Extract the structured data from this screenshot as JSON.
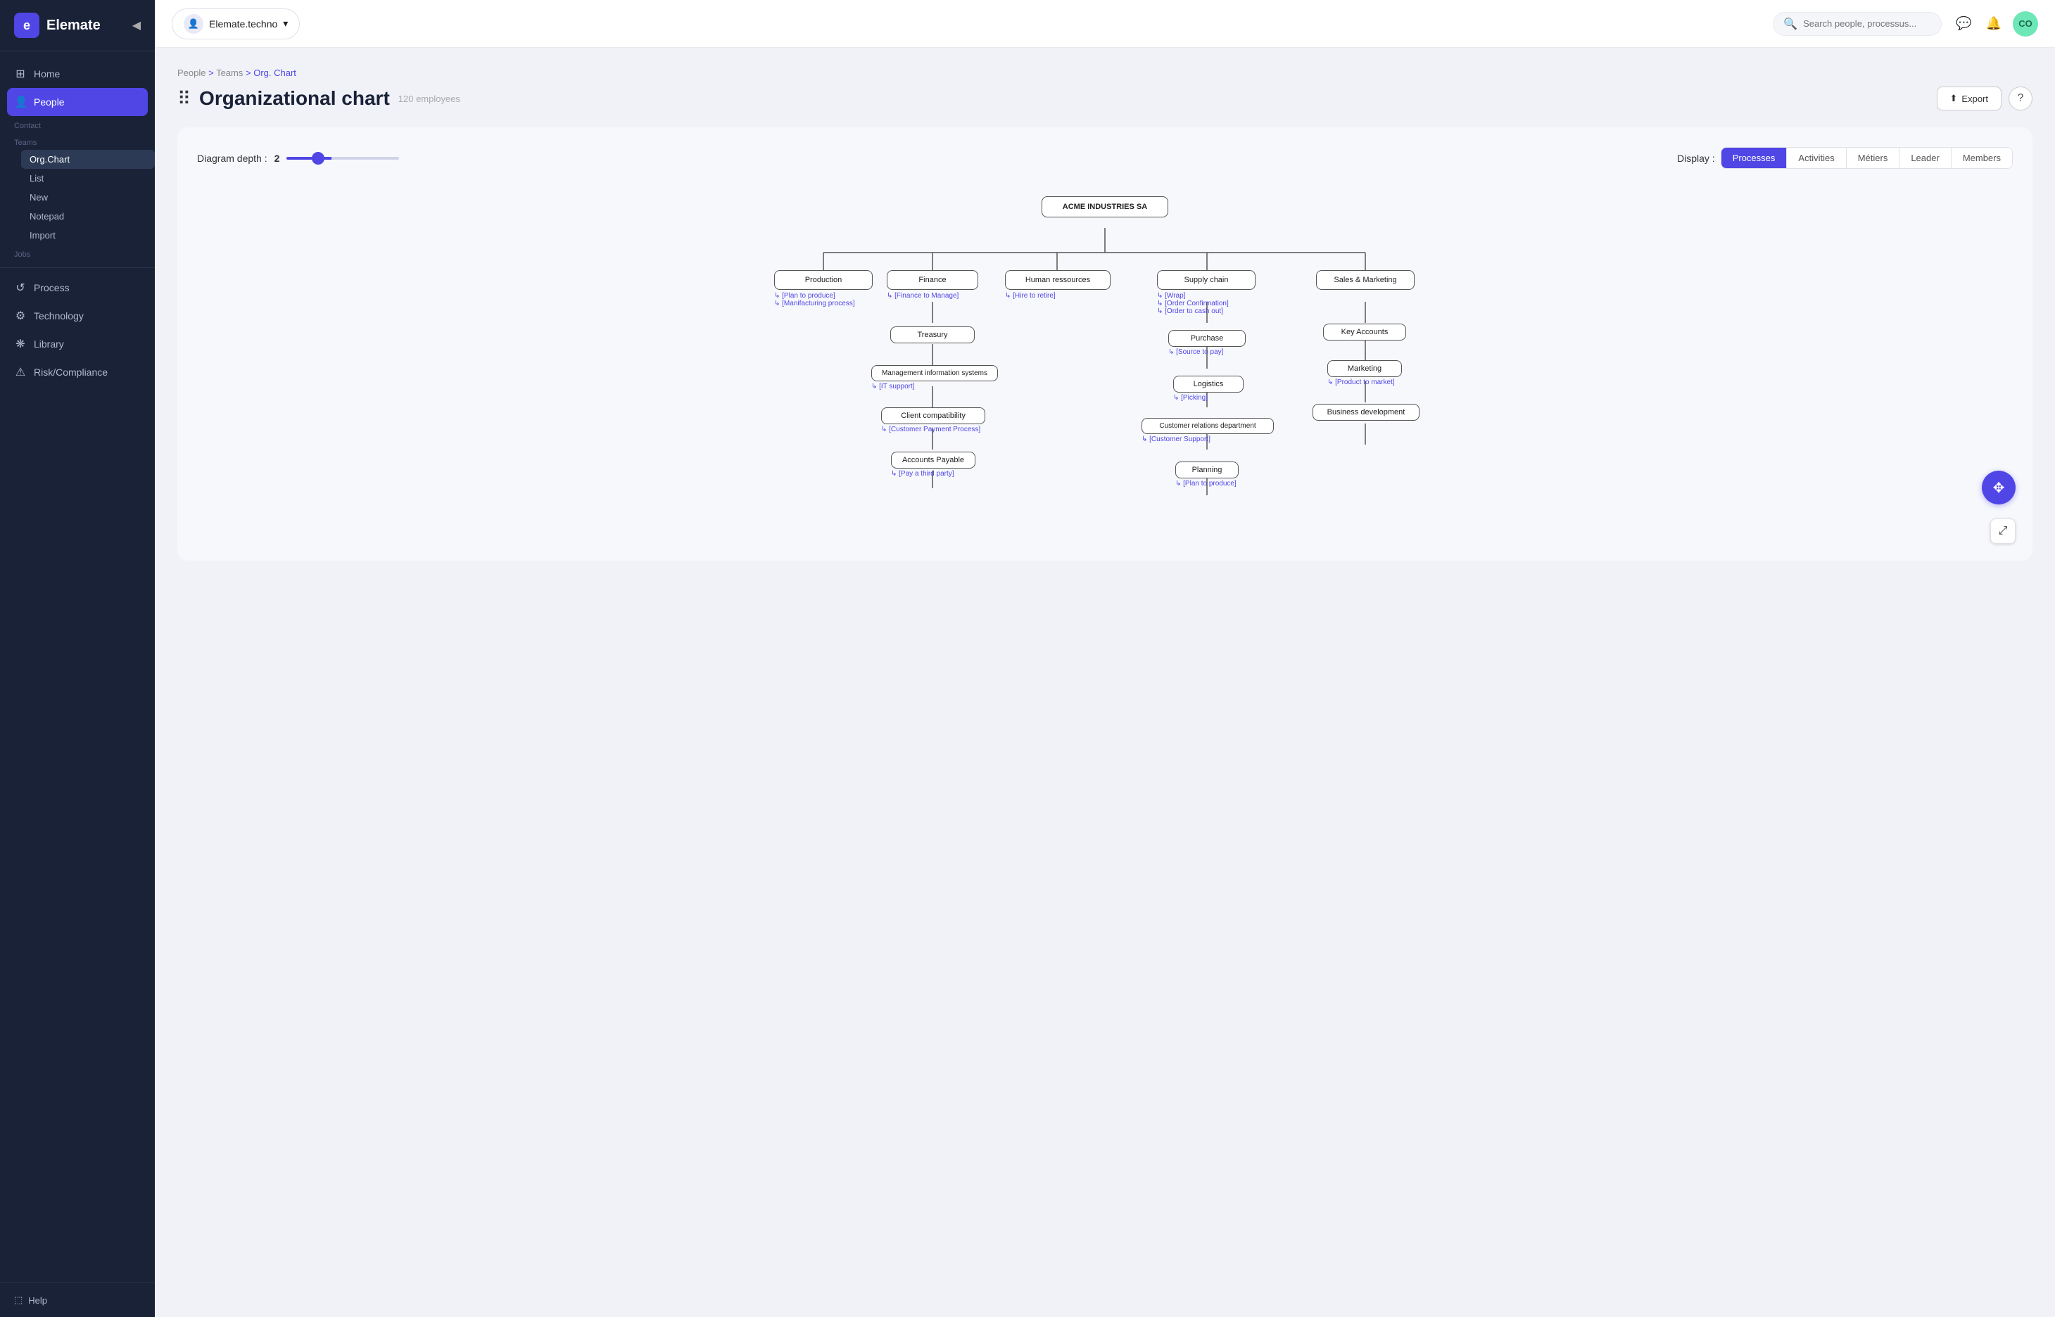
{
  "app": {
    "name": "Elemate",
    "logo_char": "e"
  },
  "topbar": {
    "workspace": "Elemate.techno",
    "search_placeholder": "Search people, processus...",
    "avatar_initials": "CO",
    "avatar_color": "#6ee7b7"
  },
  "sidebar": {
    "nav_items": [
      {
        "id": "home",
        "label": "Home",
        "icon": "⊞"
      },
      {
        "id": "people",
        "label": "People",
        "icon": "👤",
        "active": true
      },
      {
        "id": "process",
        "label": "Process",
        "icon": "↺"
      },
      {
        "id": "technology",
        "label": "Technology",
        "icon": "⚙"
      },
      {
        "id": "library",
        "label": "Library",
        "icon": "❋"
      },
      {
        "id": "risk",
        "label": "Risk/Compliance",
        "icon": "⚠"
      }
    ],
    "people_sections": [
      {
        "label": "Contact"
      },
      {
        "label": "Teams",
        "sub": [
          "Org.Chart",
          "List",
          "New",
          "Notepad",
          "Import"
        ]
      }
    ],
    "jobs_label": "Jobs",
    "help_label": "Help"
  },
  "breadcrumb": {
    "items": [
      "People",
      "Teams",
      "Org. Chart"
    ]
  },
  "page": {
    "title": "Organizational chart",
    "subtitle": "120 employees",
    "export_label": "Export",
    "help_label": "?"
  },
  "chart_controls": {
    "depth_label": "Diagram depth :",
    "depth_value": "2",
    "display_label": "Display :",
    "display_buttons": [
      {
        "label": "Processes",
        "active": true
      },
      {
        "label": "Activities",
        "active": false
      },
      {
        "label": "Métiers",
        "active": false
      },
      {
        "label": "Leader",
        "active": false
      },
      {
        "label": "Members",
        "active": false
      }
    ]
  },
  "org": {
    "root": "ACME INDUSTRIES SA",
    "departments": [
      {
        "name": "Production",
        "links": [
          "[Plan to produce]",
          "[Manifacturing process]"
        ]
      },
      {
        "name": "Finance",
        "links": [
          "[Finance to Manage]"
        ],
        "children": [
          {
            "name": "Treasury",
            "links": []
          },
          {
            "name": "Management information systems",
            "links": [
              "[IT support]"
            ]
          },
          {
            "name": "Client compatibility",
            "links": [
              "[Customer Payment Process]"
            ]
          },
          {
            "name": "Accounts Payable",
            "links": [
              "[Pay a third party]"
            ]
          }
        ]
      },
      {
        "name": "Human ressources",
        "links": [
          "[Hire to retire]"
        ]
      },
      {
        "name": "Supply chain",
        "links": [
          "[Wrap]",
          "[Order Confirmation]",
          "[Order to cash out]"
        ],
        "children": [
          {
            "name": "Purchase",
            "links": [
              "[Source to pay]"
            ]
          },
          {
            "name": "Logistics",
            "links": [
              "[Picking]"
            ]
          },
          {
            "name": "Customer relations department",
            "links": [
              "[Customer Support]"
            ]
          },
          {
            "name": "Planning",
            "links": [
              "[Plan to produce]"
            ]
          }
        ]
      },
      {
        "name": "Sales & Marketing",
        "links": [],
        "children": [
          {
            "name": "Key Accounts",
            "links": []
          },
          {
            "name": "Marketing",
            "links": [
              "[Product to market]"
            ]
          },
          {
            "name": "Business development",
            "links": []
          }
        ]
      }
    ]
  },
  "float_buttons": {
    "move_icon": "✥",
    "expand_icon": "⤢"
  }
}
